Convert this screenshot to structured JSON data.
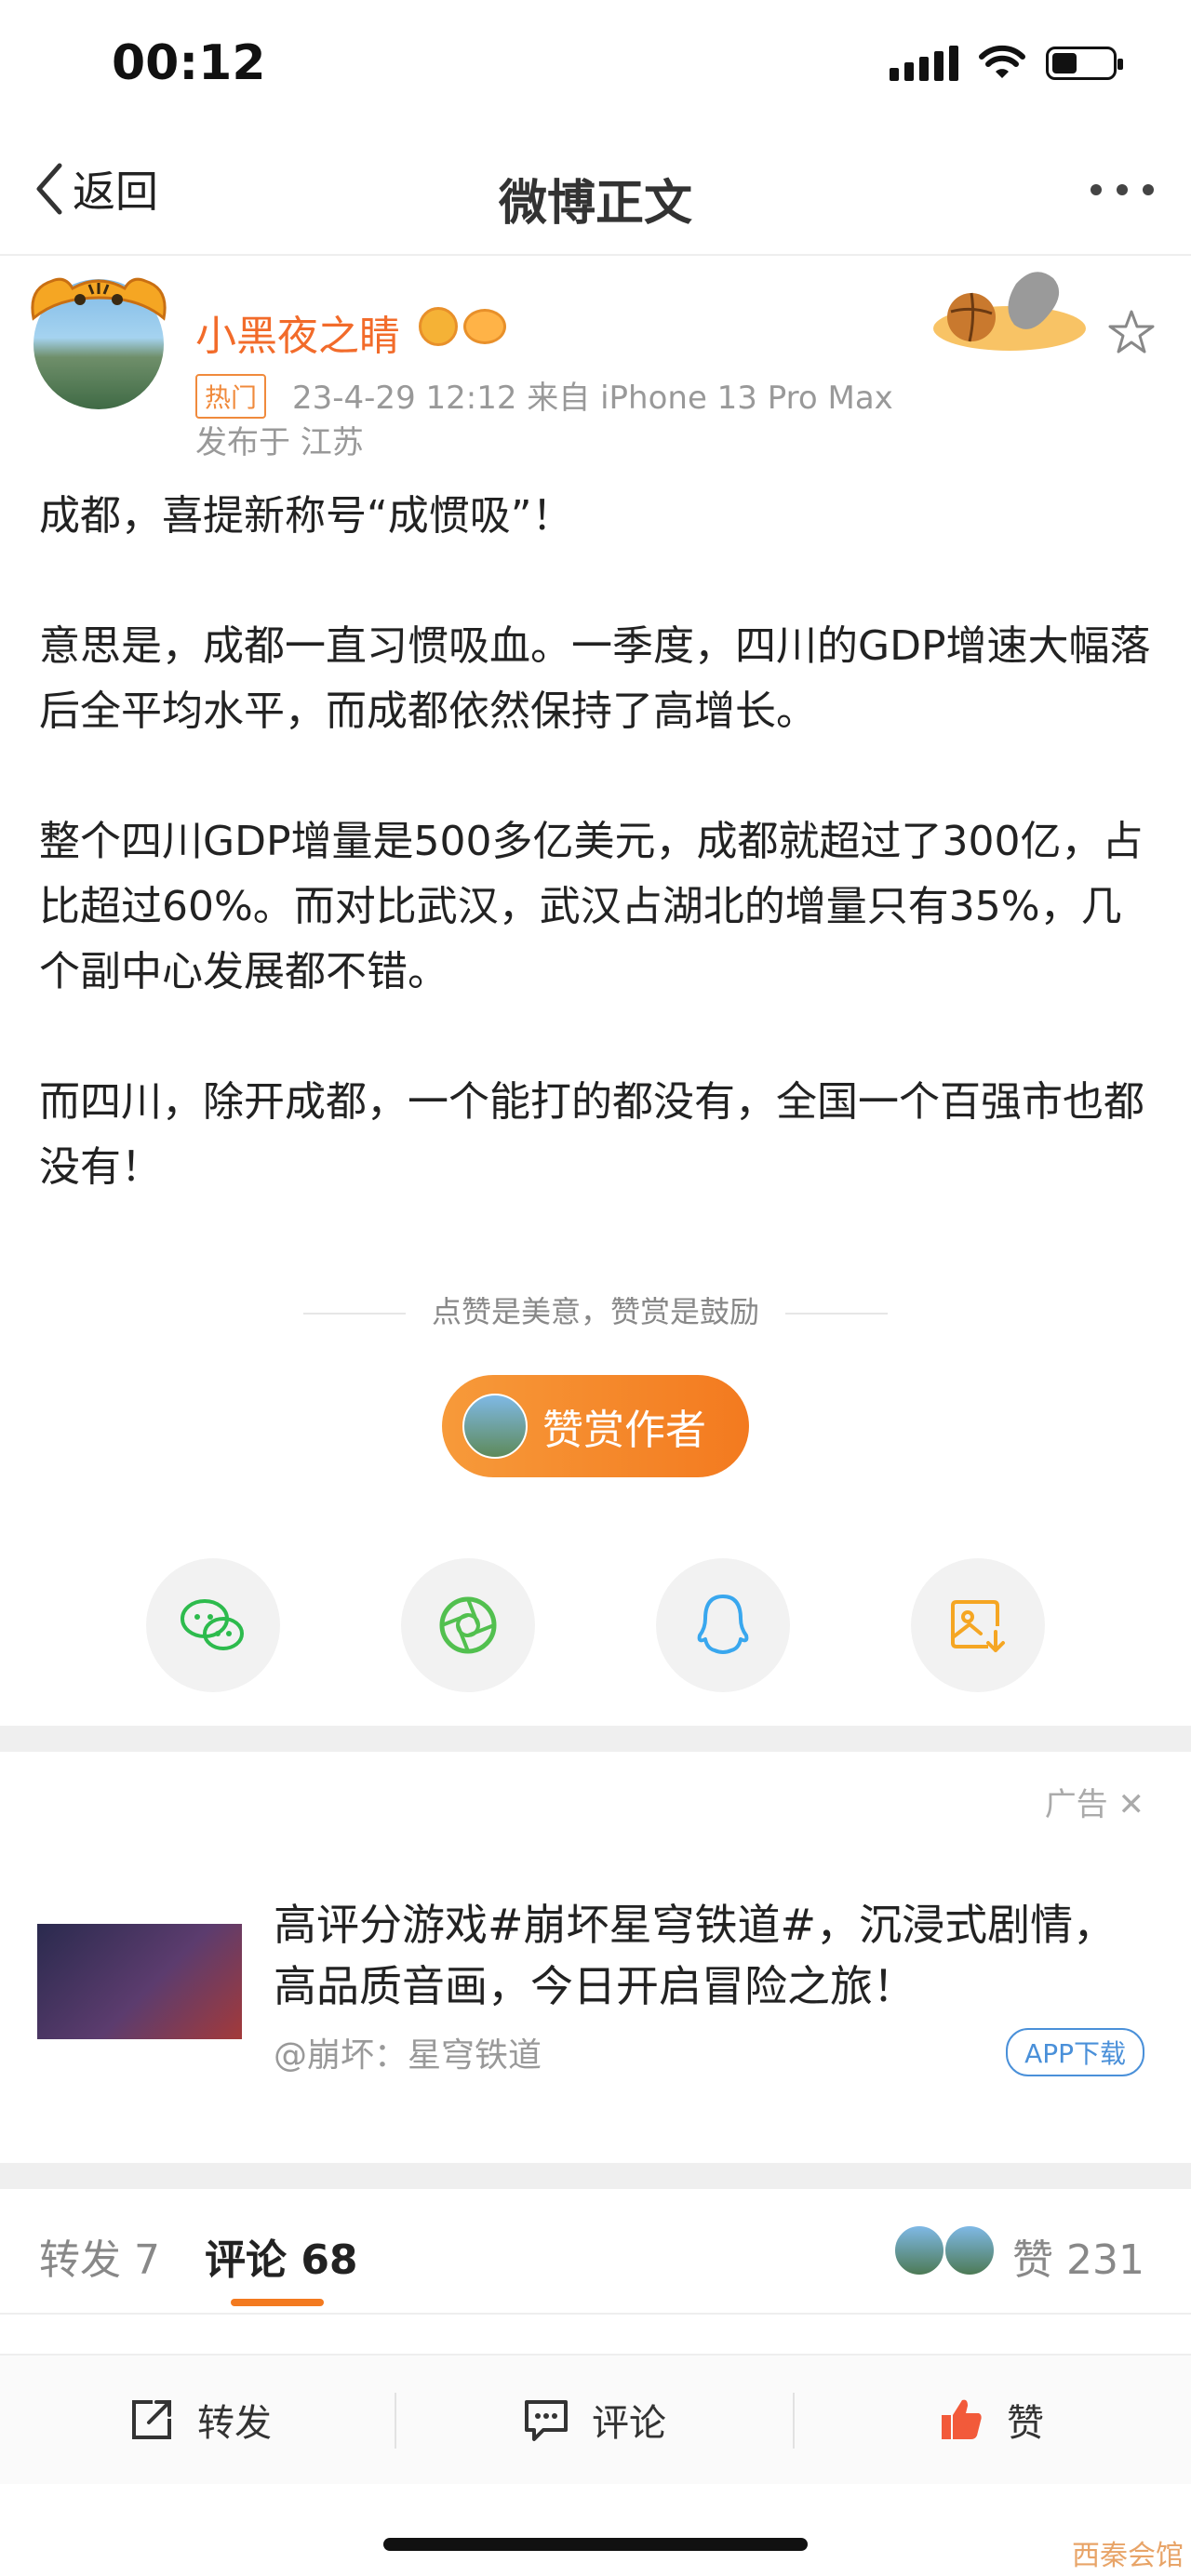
{
  "status_bar": {
    "time": "00:12"
  },
  "nav": {
    "back_label": "返回",
    "title": "微博正文"
  },
  "post": {
    "author": "小黑夜之睛",
    "hot_tag": "热门",
    "meta": "23-4-29 12:12  来自 iPhone 13 Pro Max",
    "location": "发布于 江苏",
    "paragraphs": [
      "成都，喜提新称号“成惯吸”！",
      "意思是，成都一直习惯吸血。一季度，四川的GDP增速大幅落后全平均水平，而成都依然保持了高增长。",
      "整个四川GDP增量是500多亿美元，成都就超过了300亿，占比超过60%。而对比武汉，武汉占湖北的增量只有35%，几个副中心发展都不错。",
      "而四川，除开成都，一个能打的都没有，全国一个百强市也都没有！"
    ]
  },
  "reward": {
    "tip": "点赞是美意，赞赏是鼓励",
    "button_label": "赞赏作者"
  },
  "share": {
    "icons": [
      "wechat-icon",
      "moments-icon",
      "qq-icon",
      "save-image-icon"
    ]
  },
  "ad": {
    "label": "广告",
    "text": "高评分游戏#崩坏星穹铁道#，沉浸式剧情，高品质音画，今日开启冒险之旅！",
    "source": "@崩坏：星穹铁道",
    "download_label": "APP下载"
  },
  "tabs": {
    "repost": "转发 7",
    "comments": "评论 68",
    "likes": "赞 231"
  },
  "toolbar": {
    "repost": "转发",
    "comment": "评论",
    "like": "赞"
  },
  "colors": {
    "accent": "#f37a1f",
    "username": "#f26b2a",
    "link_blue": "#4a90d9"
  },
  "watermark": "西秦会馆"
}
